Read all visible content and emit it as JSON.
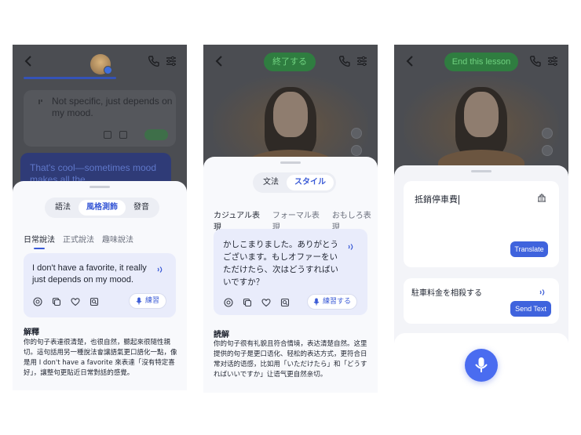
{
  "panel1": {
    "chat_message": "Not specific, just depends on my mood.",
    "user_message": "That's cool—sometimes mood makes all the",
    "tabs": [
      "語法",
      "風格測飾",
      "發音"
    ],
    "subtabs": [
      "日常說法",
      "正式說法",
      "趣味說法"
    ],
    "suggestion": "I don't have a favorite, it really just depends on my mood.",
    "practice_label": "練習",
    "explanation_title": "解釋",
    "explanation": "你的句子表達很清楚，也很自然，聽起來很隨性親切。這句話用另一種說法會讓語氣更口語化一點，像是用 I don't have a favorite 來表達「沒有特定喜好」，讓整句更貼近日常對話的感覺。"
  },
  "panel2": {
    "top_pill": "終了する",
    "tabs": [
      "文法",
      "スタイル"
    ],
    "subtabs": [
      "カジュアル表現",
      "フォーマル表現",
      "おもしろ表現"
    ],
    "suggestion": "かしこまりました。ありがとうございます。もしオファーをいただけたら、次はどうすればいいですか？",
    "practice_label": "練習する",
    "explanation_title": "読解",
    "explanation": "你的句子很有礼貌且符合情境，表达清楚自然。这里提供的句子是更口语化、轻松的表达方式，更符合日常对话的语感，比如用「いただけたら」和「どうすればいいですか」让语气更自然亲切。"
  },
  "panel3": {
    "top_pill": "End this lesson",
    "input_text": "抵銷停車費",
    "translate_label": "Translate",
    "result_text": "駐車料金を相殺する",
    "send_label": "Send Text"
  },
  "colors": {
    "accent": "#3a5ad6",
    "button": "#3f63dd",
    "mic": "#4a6cf0"
  }
}
